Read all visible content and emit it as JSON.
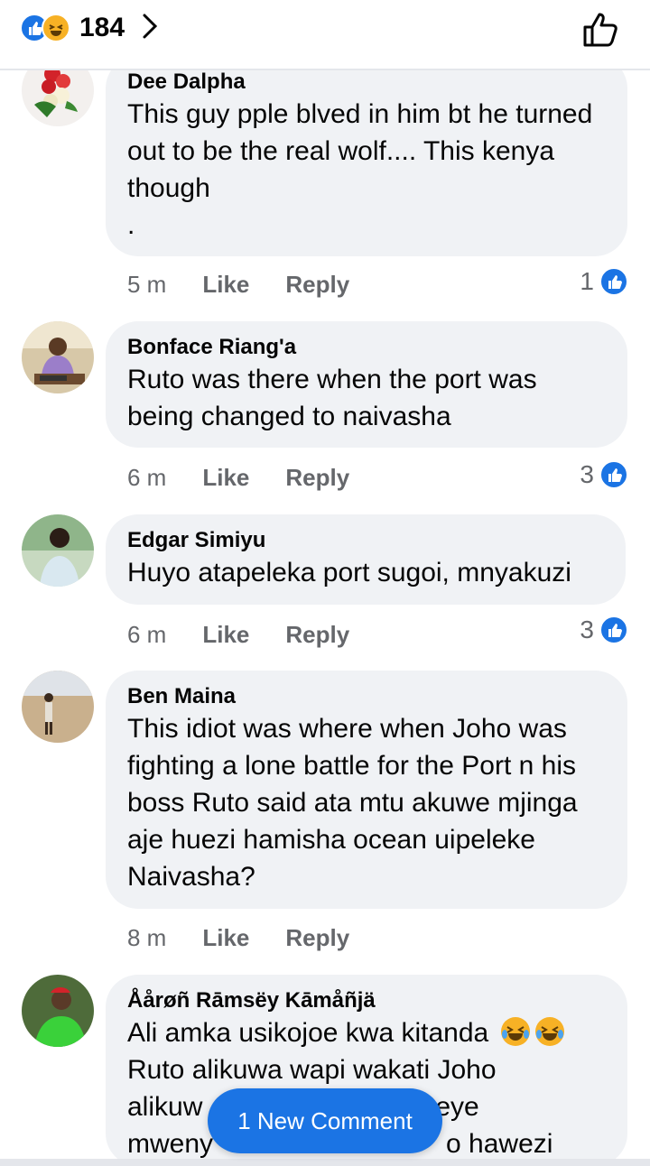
{
  "header": {
    "reaction_count": "184",
    "reaction_icons": [
      "like-icon",
      "haha-icon"
    ],
    "accent": "#1b74e4"
  },
  "comments": [
    {
      "name": "Dee Dalpha",
      "text": "This guy pple blved in him bt he turned out to be the real wolf.... This kenya though\n.",
      "time": "5 m",
      "like": "Like",
      "reply": "Reply",
      "reactions": "1"
    },
    {
      "name": "Bonface Riang'a",
      "text": "Ruto was there when the port was being changed to naivasha",
      "time": "6 m",
      "like": "Like",
      "reply": "Reply",
      "reactions": "3"
    },
    {
      "name": "Edgar Simiyu",
      "text": "Huyo atapeleka port sugoi, mnyakuzi",
      "time": "6 m",
      "like": "Like",
      "reply": "Reply",
      "reactions": "3"
    },
    {
      "name": "Ben Maina",
      "text": "This idiot was where when Joho was fighting a lone battle for the Port n his boss Ruto said ata mtu akuwe mjinga aje huezi hamisha ocean uipeleke Naivasha?",
      "time": "8 m",
      "like": "Like",
      "reply": "Reply",
      "reactions": ""
    },
    {
      "name": "Åårøñ Rāmsëy Kāmåñjä",
      "text": "Ali amka usikojoe kwa kitanda",
      "text_line2": "Ruto alikuwa wapi wakati Joho",
      "text_line3_start": "alikuw",
      "text_line3_end": "eye",
      "text_line4_start": "mweny",
      "text_line4_end": "o hawezi"
    }
  ],
  "new_comment_button": "1 New Comment"
}
